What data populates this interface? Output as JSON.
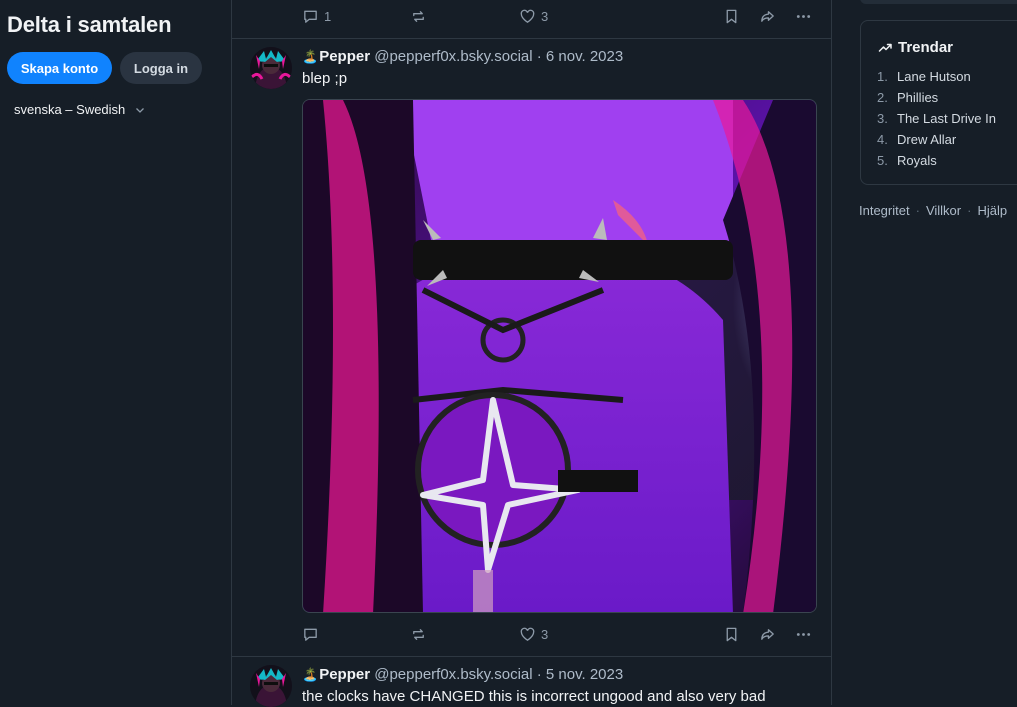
{
  "sidebar": {
    "title": "Delta i samtalen",
    "signup_label": "Skapa konto",
    "login_label": "Logga in",
    "language": "svenska – Swedish"
  },
  "feed": {
    "top_post": {
      "reply_count": "1",
      "like_count": "3"
    },
    "posts": [
      {
        "emoji": "🏝️",
        "display_name": "Pepper",
        "handle": "@pepperf0x.bsky.social",
        "separator": "·",
        "date": "6 nov. 2023",
        "text": "blep ;p",
        "like_count": "3",
        "media_alt": "image"
      },
      {
        "emoji": "🏝️",
        "display_name": "Pepper",
        "handle": "@pepperf0x.bsky.social",
        "separator": "·",
        "date": "5 nov. 2023",
        "text": "the clocks have CHANGED this is incorrect ungood and also very bad"
      }
    ]
  },
  "trending": {
    "title": "Trendar",
    "items": [
      {
        "num": "1.",
        "label": "Lane Hutson"
      },
      {
        "num": "2.",
        "label": "Phillies"
      },
      {
        "num": "3.",
        "label": "The Last Drive In"
      },
      {
        "num": "4.",
        "label": "Drew Allar"
      },
      {
        "num": "5.",
        "label": "Royals"
      }
    ]
  },
  "footer": {
    "privacy": "Integritet",
    "terms": "Villkor",
    "help": "Hjälp",
    "sep": "·"
  },
  "colors": {
    "accent": "#1083fe",
    "background": "#161e27",
    "border": "#2e3842",
    "muted": "#8d9aa8"
  },
  "icons": [
    "reply-icon",
    "repost-icon",
    "like-icon",
    "bookmark-icon",
    "share-icon",
    "more-icon",
    "chevron-down-icon",
    "trending-icon"
  ]
}
